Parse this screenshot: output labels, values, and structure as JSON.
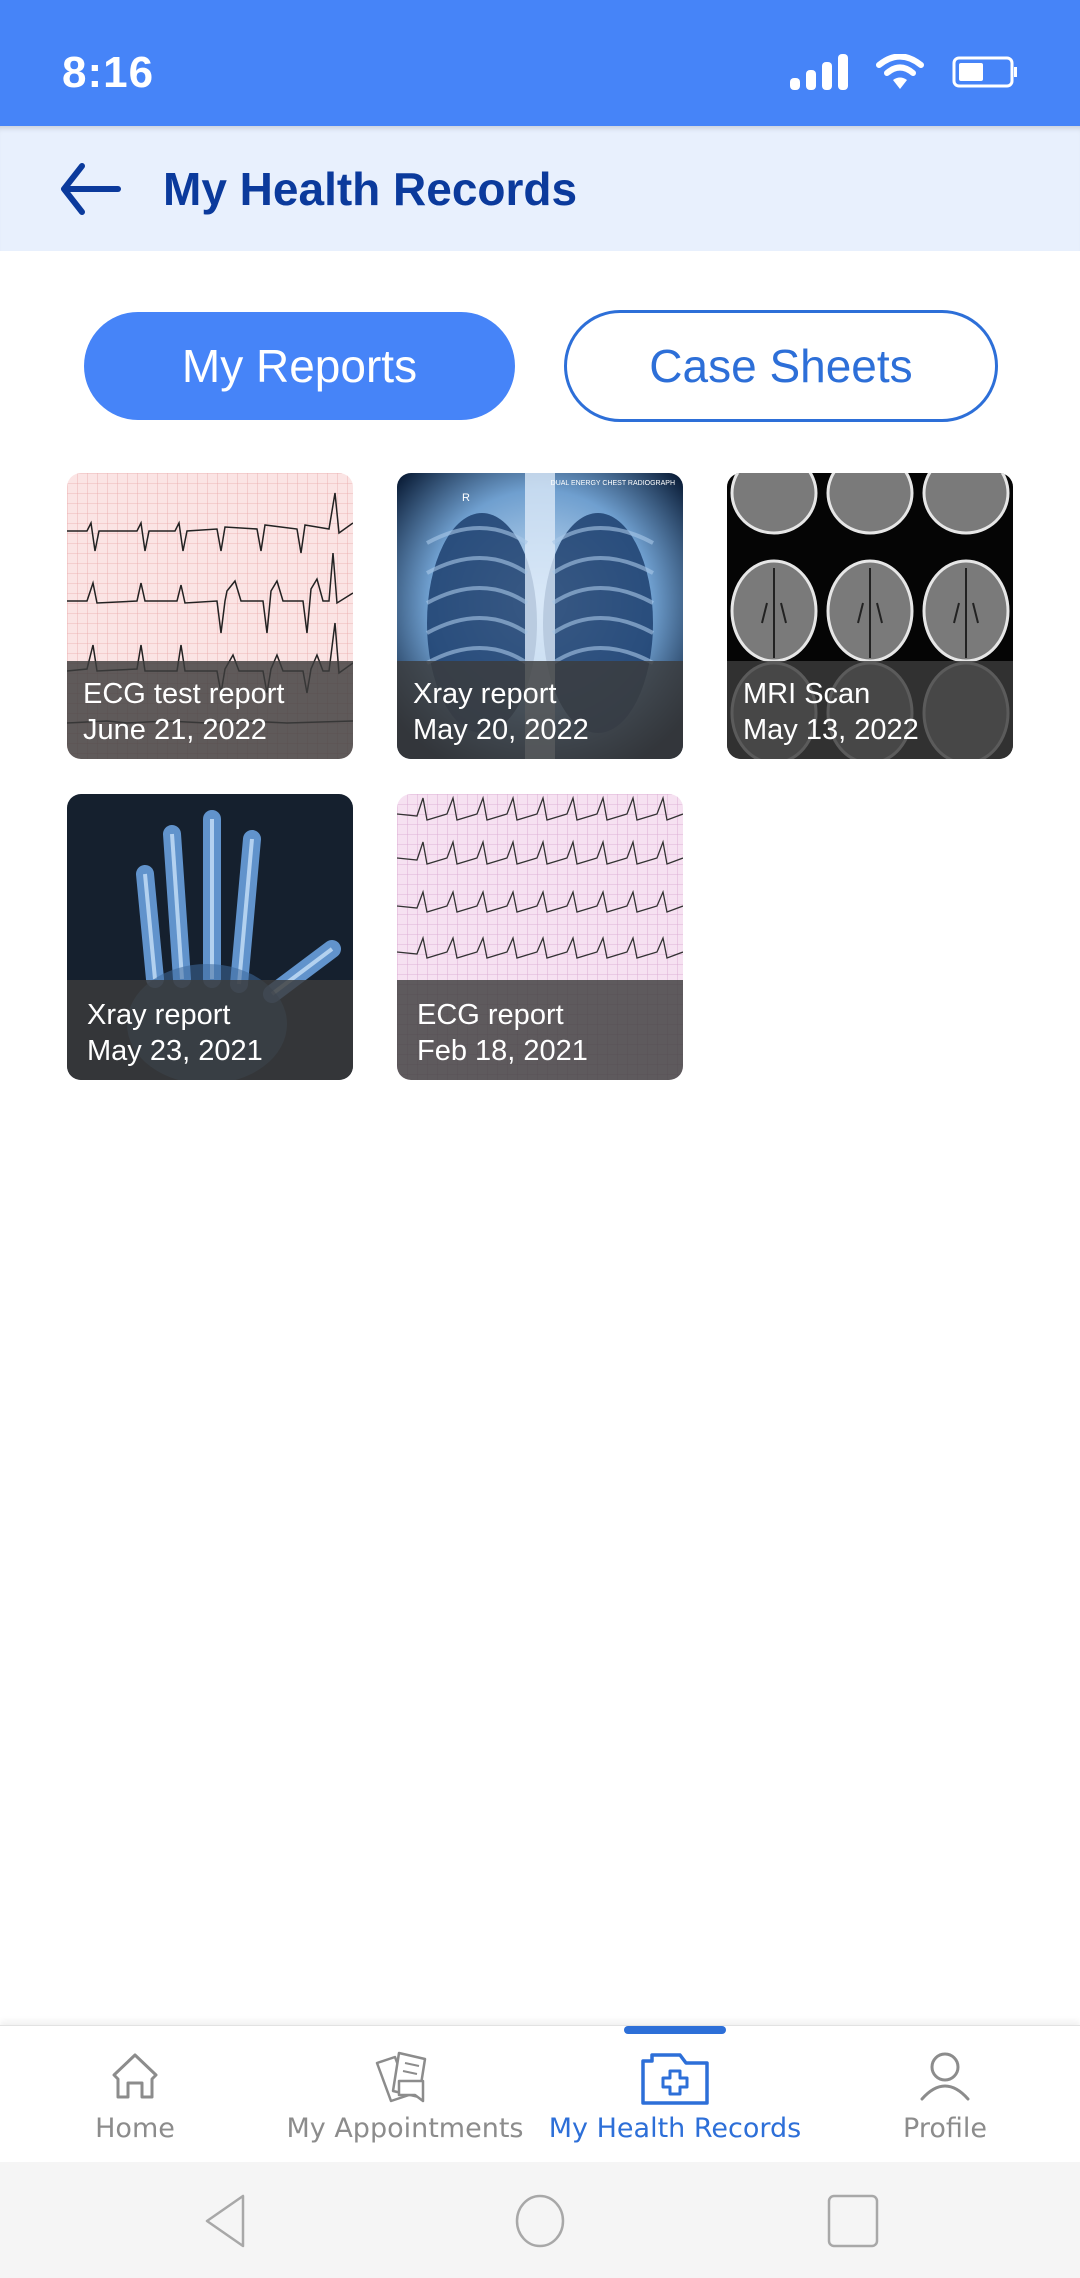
{
  "status_bar": {
    "time": "8:16",
    "icons": [
      "signal-icon",
      "wifi-icon",
      "battery-icon"
    ],
    "battery_level_percent": 50
  },
  "header": {
    "back_icon": "arrow-left-icon",
    "title": "My Health Records"
  },
  "tabs": [
    {
      "label": "My Reports",
      "active": true
    },
    {
      "label": "Case Sheets",
      "active": false
    }
  ],
  "reports": [
    {
      "title": "ECG test report",
      "date": "June 21, 2022",
      "thumbnail": "ecg-image"
    },
    {
      "title": "Xray report",
      "date": "May 20, 2022",
      "thumbnail": "chest-xray-image",
      "thumbnail_caption": "DUAL ENERGY CHEST RADIOGRAPH",
      "thumbnail_marker": "R"
    },
    {
      "title": "MRI Scan",
      "date": "May 13, 2022",
      "thumbnail": "brain-mri-image"
    },
    {
      "title": "Xray report",
      "date": "May 23, 2021",
      "thumbnail": "hand-xray-image"
    },
    {
      "title": "ECG report",
      "date": "Feb 18, 2021",
      "thumbnail": "ecg-image"
    }
  ],
  "bottom_nav": [
    {
      "label": "Home",
      "icon": "home-icon",
      "active": false
    },
    {
      "label": "My Appointments",
      "icon": "appointments-icon",
      "active": false
    },
    {
      "label": "My Health Records",
      "icon": "medical-folder-icon",
      "active": true
    },
    {
      "label": "Profile",
      "icon": "user-icon",
      "active": false
    }
  ],
  "system_nav": [
    "back-triangle-icon",
    "home-circle-icon",
    "recents-square-icon"
  ],
  "colors": {
    "primary": "#4684F8",
    "accent": "#2D6FD8",
    "title": "#0B3A9C",
    "header_bg": "#E8F0FD",
    "inactive": "#8C8C8C"
  }
}
